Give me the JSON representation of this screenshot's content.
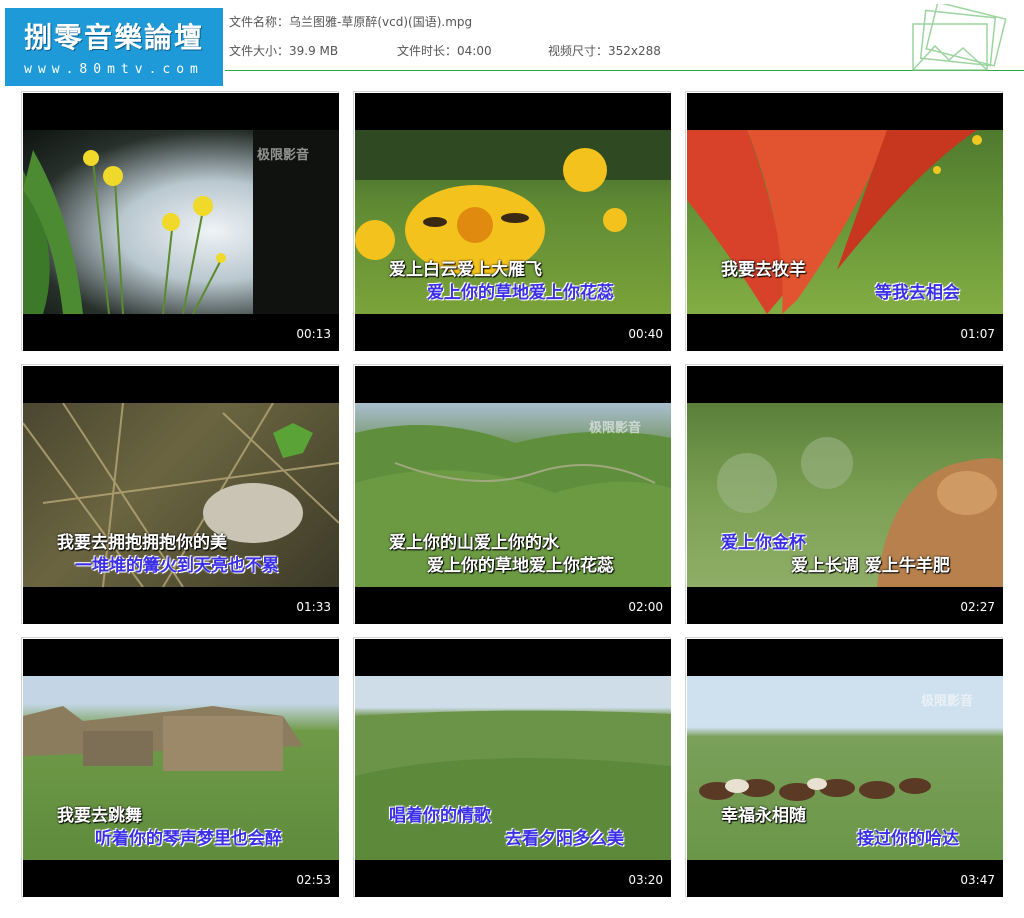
{
  "header": {
    "logo_cn": "捌零音樂論壇",
    "logo_url": "www.80mtv.com",
    "file_name_label": "文件名称：",
    "file_name": "乌兰图雅-草原醉(vcd)(国语).mpg",
    "file_size_label": "文件大小：",
    "file_size": "39.9 MB",
    "duration_label": "文件时长：",
    "duration": "04:00",
    "dimensions_label": "视频尺寸：",
    "dimensions": "352x288"
  },
  "thumbnails": [
    {
      "time": "00:13",
      "watermark": "极限影音",
      "line1": "",
      "line2": ""
    },
    {
      "time": "00:40",
      "watermark": "",
      "line1": "爱上白云爱上大雁飞",
      "line2": "爱上你的草地爱上你花蕊"
    },
    {
      "time": "01:07",
      "watermark": "",
      "line1": "我要去牧羊",
      "line2": "等我去相会"
    },
    {
      "time": "01:33",
      "watermark": "",
      "line1": "我要去拥抱拥抱你的美",
      "line2": "一堆堆的篝火到天亮也不累"
    },
    {
      "time": "02:00",
      "watermark": "极限影音",
      "line1": "爱上你的山爱上你的水",
      "line2": "爱上你的草地爱上你花蕊"
    },
    {
      "time": "02:27",
      "watermark": "",
      "line1": "爱上你金杯",
      "line2": "爱上长调 爱上牛羊肥"
    },
    {
      "time": "02:53",
      "watermark": "",
      "line1": "我要去跳舞",
      "line2": "听着你的琴声梦里也会醉"
    },
    {
      "time": "03:20",
      "watermark": "",
      "line1": "唱着你的情歌",
      "line2": "去看夕阳多么美"
    },
    {
      "time": "03:47",
      "watermark": "极限影音",
      "line1": "幸福永相随",
      "line2": "接过你的哈达"
    }
  ]
}
